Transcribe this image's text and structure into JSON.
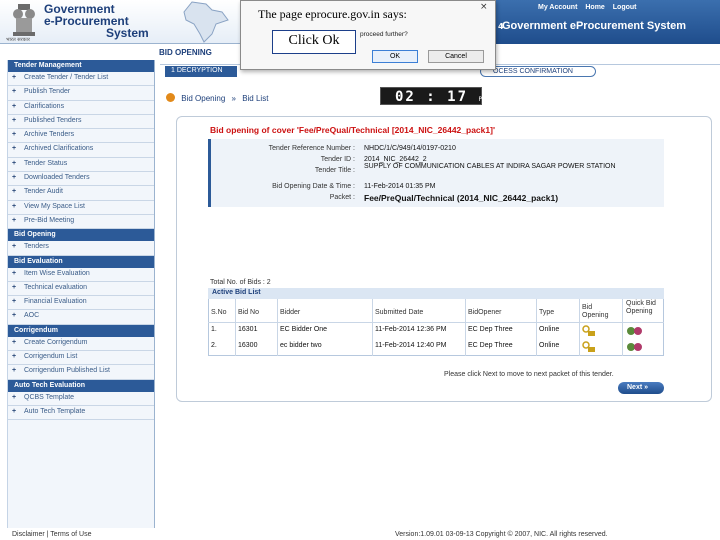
{
  "header": {
    "logo_lines": [
      "Government",
      "e-Procurement",
      "System"
    ],
    "logo_sub": "भारत सरकार",
    "top_links": [
      "My Account",
      "Home",
      "Logout"
    ],
    "system_name": "Government eProcurement System",
    "system_prefix": "4"
  },
  "sidebar": {
    "sections": [
      {
        "title": "Tender Management",
        "items": [
          "Create Tender / Tender List",
          "Publish Tender",
          "Clarifications",
          "Published Tenders",
          "Archive Tenders",
          "Archived Clarifications",
          "Tender Status",
          "Downloaded Tenders",
          "Tender Audit",
          "View My Space List",
          "Pre-Bid Meeting"
        ]
      },
      {
        "title": "Bid Opening",
        "items": [
          "Tenders"
        ]
      },
      {
        "title": "Bid Evaluation",
        "items": [
          "Item Wise Evaluation",
          "Technical evaluation",
          "Financial Evaluation",
          "AOC"
        ]
      },
      {
        "title": "Corrigendum",
        "items": [
          "Create Corrigendum",
          "Corrigendum List",
          "Corrigendum Published List"
        ]
      },
      {
        "title": "Auto Tech Evaluation",
        "items": [
          "QCBS Template",
          "Auto Tech Template"
        ]
      }
    ],
    "item_marker": "+"
  },
  "footer": {
    "left": "Disclaimer  |  Terms of Use",
    "right": "Version:1.09.01 03-09-13          Copyright © 2007, NIC. All rights reserved."
  },
  "page": {
    "tab_label": "BID OPENING",
    "tab_decryption": "1  DECRYPTION",
    "tab_confirmation": "OCESS CONFIRMATION",
    "breadcrumb_1": "Bid Opening",
    "breadcrumb_sep": "»",
    "breadcrumb_2": "Bid List",
    "timer_value": "02 : 17",
    "timer_unit": "PM"
  },
  "panel": {
    "title": "Bid opening of cover 'Fee/PreQual/Technical [2014_NIC_26442_pack1]'",
    "fields": [
      {
        "label": "Tender Reference Number :",
        "value": "NHDC/1/C/949/14/0197-0210"
      },
      {
        "label": "Tender ID :",
        "value": "2014_NIC_26442_2"
      },
      {
        "label": "Tender Title :",
        "value": "SUPPLY OF COMMUNICATION CABLES AT INDIRA SAGAR POWER STATION"
      },
      {
        "label": "Bid Opening Date & Time :",
        "value": "11-Feb-2014 01:35 PM"
      },
      {
        "label": "Packet :",
        "value": "Fee/PreQual/Technical (2014_NIC_26442_pack1)"
      }
    ],
    "total_bids": "Total No. of Bids : 2",
    "table_caption": "Active Bid List",
    "columns": [
      "S.No",
      "Bid No",
      "Bidder",
      "Submitted Date",
      "BidOpener",
      "Type",
      "Bid Opening",
      "Quick Bid Opening"
    ],
    "rows": [
      {
        "sno": "1.",
        "bid_no": "16301",
        "bidder": "EC Bidder One",
        "submitted": "11-Feb-2014 12:36 PM",
        "opener": "EC Dep Three",
        "type": "Online"
      },
      {
        "sno": "2.",
        "bid_no": "16300",
        "bidder": "ec bidder two",
        "submitted": "11-Feb-2014 12:40 PM",
        "opener": "EC Dep Three",
        "type": "Online"
      }
    ],
    "note": "Please click Next to move to next packet of this tender.",
    "next_label": "Next »"
  },
  "dialog": {
    "title": "The page eprocure.gov.in says:",
    "message": "proceed further?",
    "ok_label": "OK",
    "cancel_label": "Cancel",
    "close_glyph": "×",
    "annotation": "Click Ok"
  },
  "colors": {
    "brand_blue": "#2c5a98",
    "title_red": "#cc1111",
    "header_dark": "#1f4d8c"
  }
}
